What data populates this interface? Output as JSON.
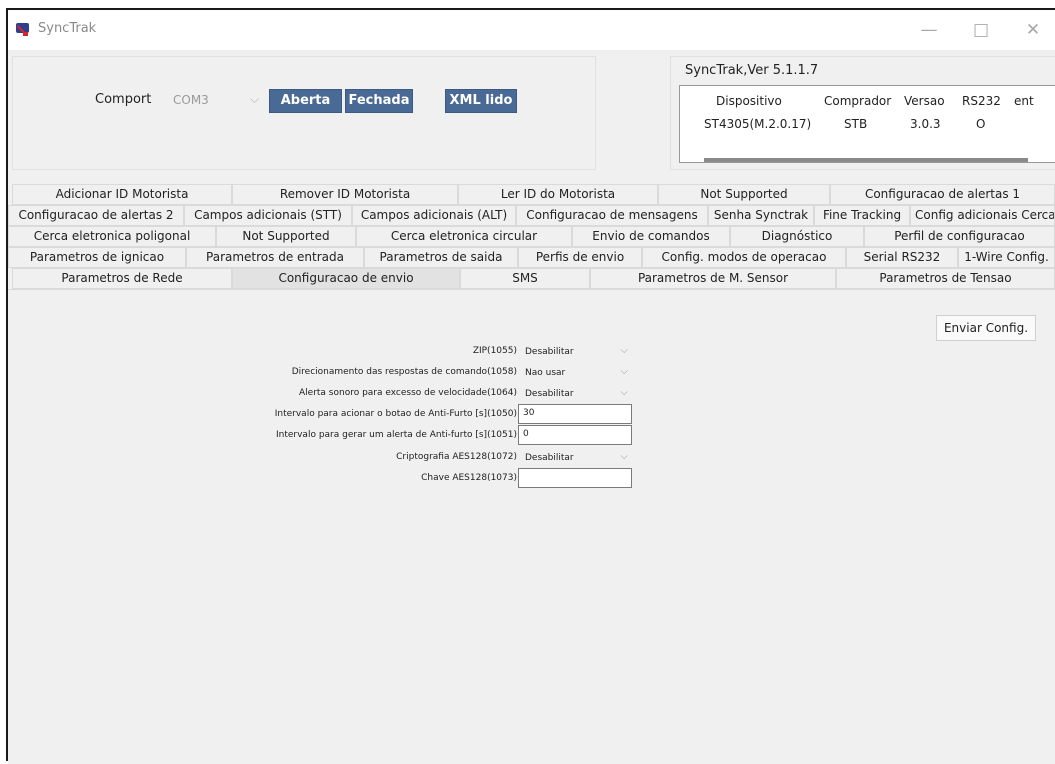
{
  "window": {
    "title": "SyncTrak",
    "controls": {
      "minimize": "—",
      "maximize": "□",
      "close": "✕"
    }
  },
  "connection": {
    "comport_label": "Comport",
    "comport_value": "COM3",
    "open_label": "Aberta",
    "close_label": "Fechada",
    "xml_label": "XML lido"
  },
  "device": {
    "version_label": "SyncTrak,Ver 5.1.1.7",
    "headers": [
      "Dispositivo",
      "Comprador",
      "Versao",
      "RS232",
      "ent"
    ],
    "row": [
      "ST4305(M.2.0.17)",
      "STB",
      "3.0.3",
      "O",
      ""
    ]
  },
  "tabs": {
    "row1": [
      "Adicionar ID Motorista",
      "Remover ID Motorista",
      "Ler ID do Motorista",
      "Not Supported",
      "Configuracao de alertas 1"
    ],
    "row2": [
      "Configuracao de alertas 2",
      "Campos adicionais (STT)",
      "Campos adicionais (ALT)",
      "Configuracao de mensagens",
      "Senha Synctrak",
      "Fine Tracking",
      "Config adicionais Cerca"
    ],
    "row3": [
      "Cerca eletronica poligonal",
      "Not Supported",
      "Cerca eletronica circular",
      "Envio de comandos",
      "Diagnóstico",
      "Perfil de configuracao"
    ],
    "row4": [
      "Parametros de ignicao",
      "Parametros de entrada",
      "Parametros de saida",
      "Perfis de envio",
      "Config. modos de operacao",
      "Serial RS232",
      "1-Wire Config."
    ],
    "row5": [
      "Parametros de Rede",
      "Configuracao de envio",
      "SMS",
      "Parametros de M. Sensor",
      "Parametros de Tensao"
    ],
    "active": "Configuracao de envio"
  },
  "form": {
    "send_button": "Enviar Config.",
    "fields": [
      {
        "label": "ZIP(1055)",
        "value": "Desabilitar",
        "kind": "select"
      },
      {
        "label": "Direcionamento das respostas de comando(1058)",
        "value": "Nao usar",
        "kind": "select"
      },
      {
        "label": "Alerta sonoro para excesso de velocidade(1064)",
        "value": "Desabilitar",
        "kind": "select"
      },
      {
        "label": "Intervalo para acionar o botao de Anti-Furto [s](1050)",
        "value": "30",
        "kind": "input"
      },
      {
        "label": "Intervalo para gerar um alerta de Anti-furto [s](1051)",
        "value": "0",
        "kind": "input"
      },
      {
        "label": "Criptografia AES128(1072)",
        "value": "Desabilitar",
        "kind": "select"
      },
      {
        "label": "Chave AES128(1073)",
        "value": "",
        "kind": "input"
      }
    ]
  },
  "icons": {
    "app": "synctrak-logo-icon",
    "dropdown": "chevron-down-icon"
  },
  "colors": {
    "accent": "#4a6a96",
    "window_border": "#1a1a1a"
  }
}
